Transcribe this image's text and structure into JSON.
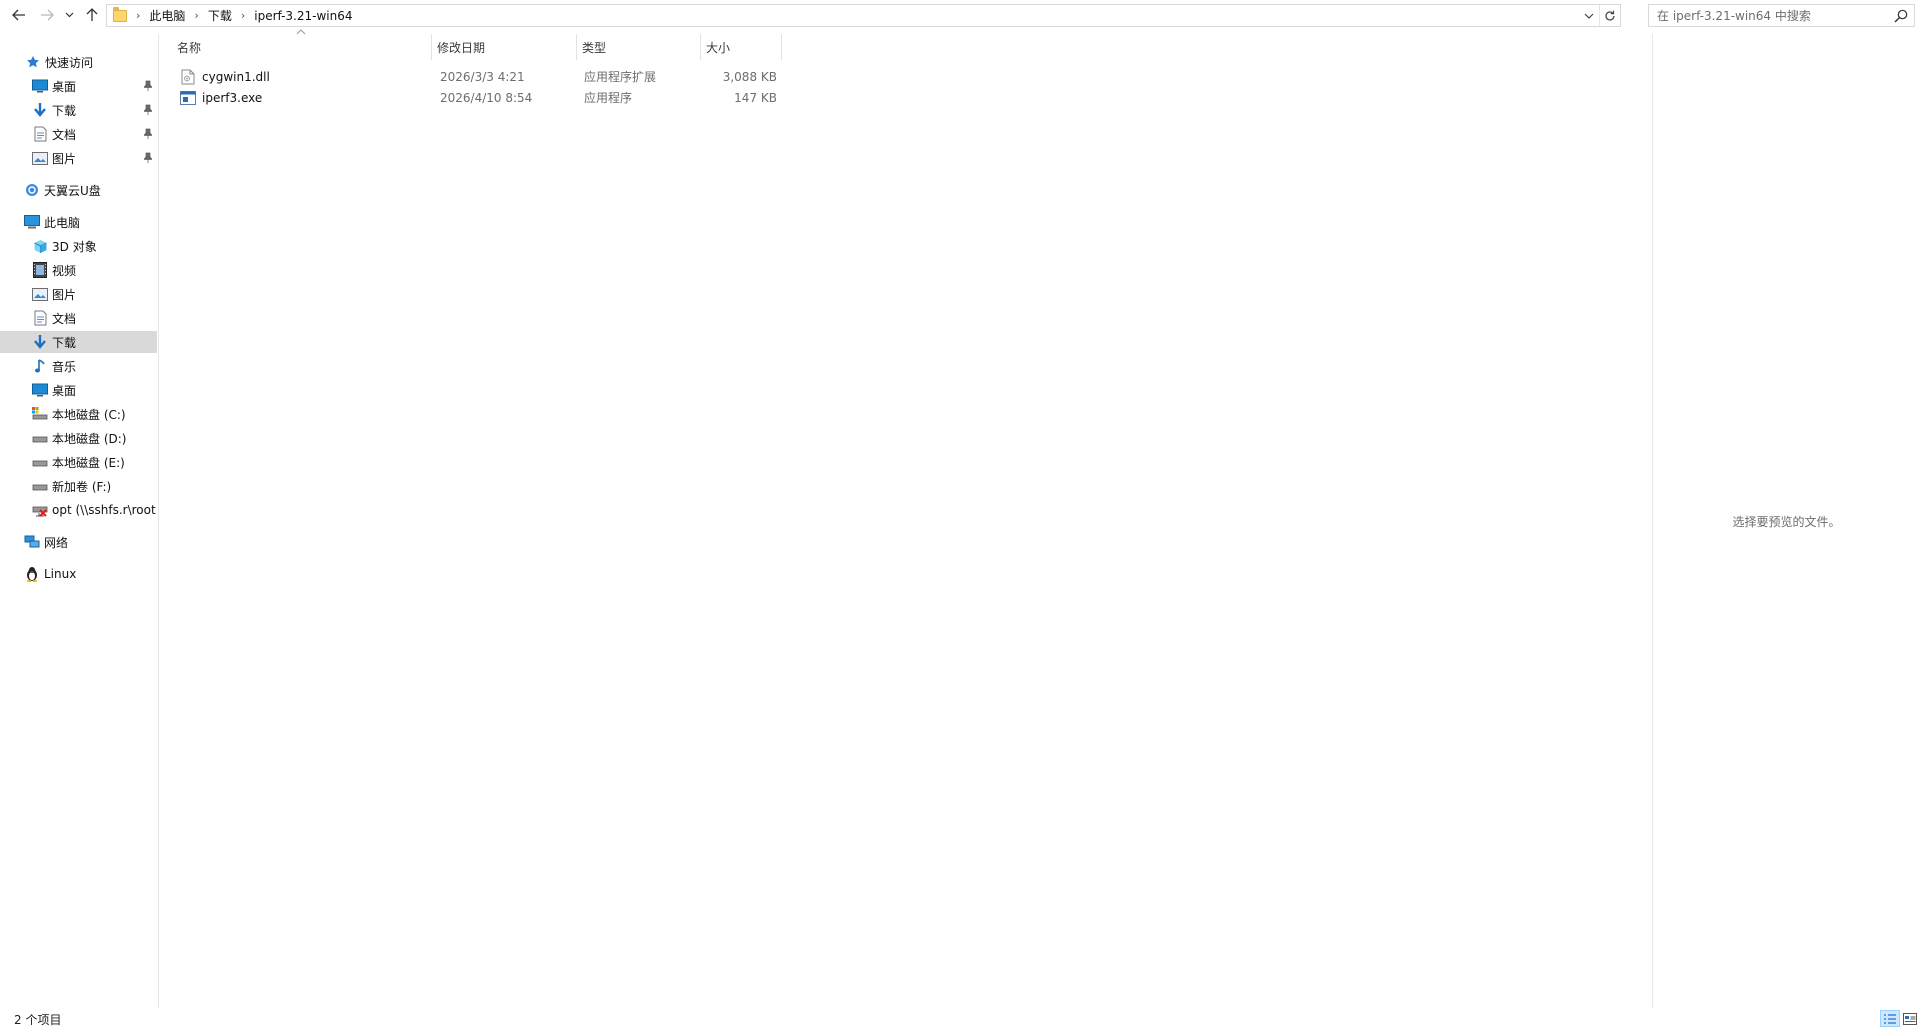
{
  "breadcrumb": [
    "此电脑",
    "下载",
    "iperf-3.21-win64"
  ],
  "search": {
    "placeholder": "在 iperf-3.21-win64 中搜索"
  },
  "nav": {
    "quick_access": "快速访问",
    "qa_items": [
      "桌面",
      "下载",
      "文档",
      "图片"
    ],
    "cloud": "天翼云U盘",
    "this_pc": "此电脑",
    "pc_items": [
      "3D 对象",
      "视频",
      "图片",
      "文档",
      "下载",
      "音乐",
      "桌面",
      "本地磁盘 (C:)",
      "本地磁盘 (D:)",
      "本地磁盘 (E:)",
      "新加卷 (F:)",
      "opt (\\\\sshfs.r\\root"
    ],
    "network": "网络",
    "linux": "Linux",
    "selected": "下载"
  },
  "columns": {
    "name": "名称",
    "date": "修改日期",
    "type": "类型",
    "size": "大小"
  },
  "files": [
    {
      "name": "cygwin1.dll",
      "date": "2026/3/3 4:21",
      "type": "应用程序扩展",
      "size": "3,088 KB",
      "icon": "dll-file-icon"
    },
    {
      "name": "iperf3.exe",
      "date": "2026/4/10 8:54",
      "type": "应用程序",
      "size": "147 KB",
      "icon": "exe-file-icon"
    }
  ],
  "preview": {
    "text": "选择要预览的文件。"
  },
  "status": {
    "count": "2 个项目"
  },
  "colors": {
    "selected_bg": "#d9d9d9",
    "accent": "#0078d7",
    "folder": "#fcd669"
  }
}
